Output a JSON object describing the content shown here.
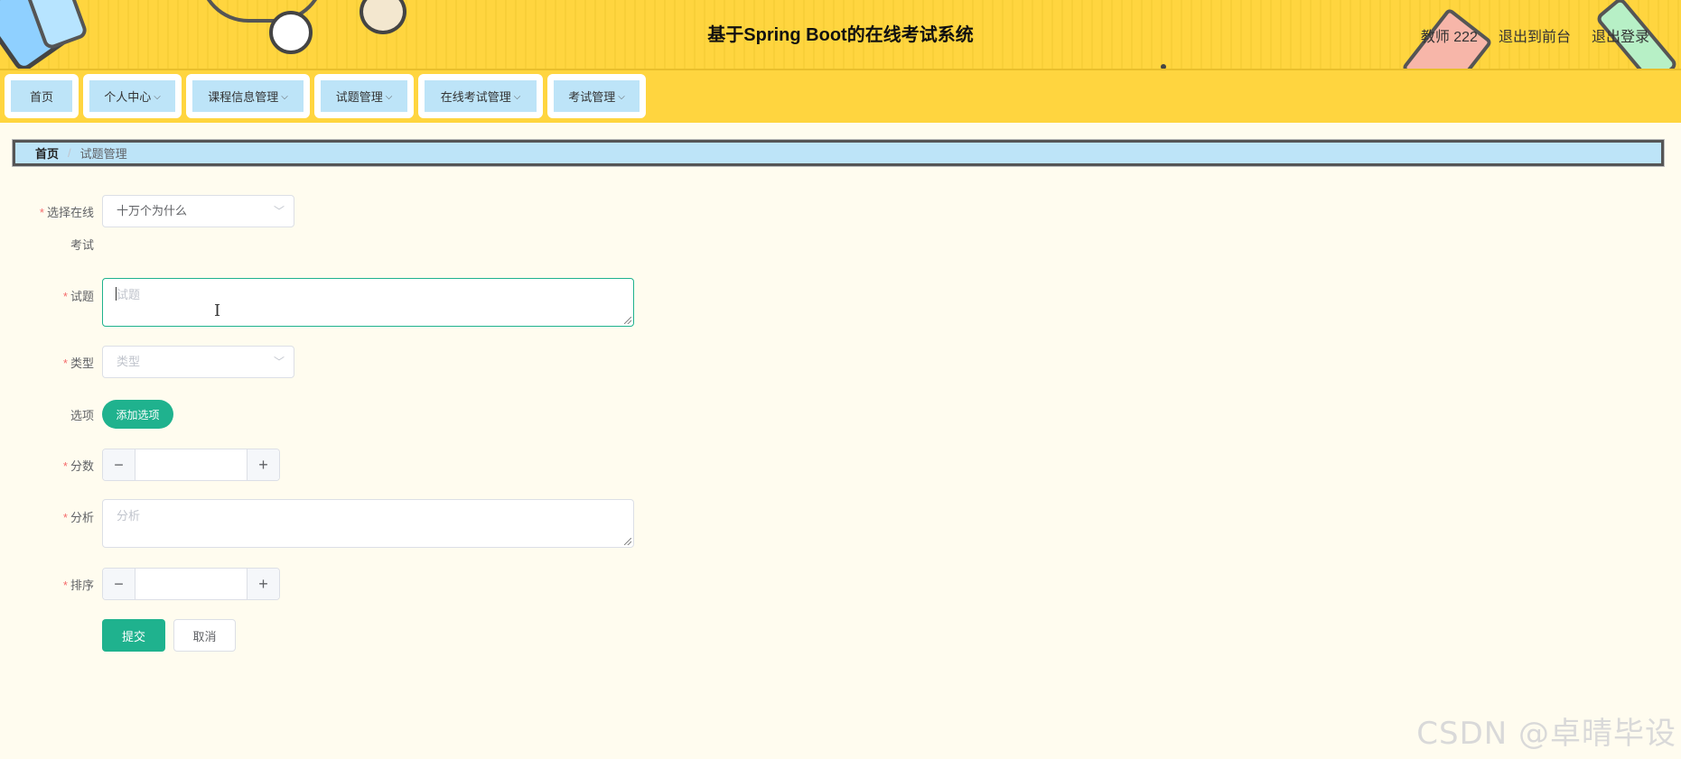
{
  "header": {
    "title": "基于Spring Boot的在线考试系统",
    "user_label": "教师 222",
    "back_to_front_label": "退出到前台",
    "logout_label": "退出登录"
  },
  "nav": {
    "items": [
      {
        "label": "首页",
        "has_dropdown": false
      },
      {
        "label": "个人中心",
        "has_dropdown": true
      },
      {
        "label": "课程信息管理",
        "has_dropdown": true
      },
      {
        "label": "试题管理",
        "has_dropdown": true
      },
      {
        "label": "在线考试管理",
        "has_dropdown": true
      },
      {
        "label": "考试管理",
        "has_dropdown": true
      }
    ],
    "chevron": "⌵"
  },
  "breadcrumb": {
    "home": "首页",
    "separator": "/",
    "current": "试题管理"
  },
  "form": {
    "required_mark": "*",
    "exam": {
      "label_line1": "选择在线",
      "label_line2": "考试",
      "value": "十万个为什么"
    },
    "question": {
      "label": "试题",
      "placeholder": "试题"
    },
    "type": {
      "label": "类型",
      "placeholder": "类型"
    },
    "options": {
      "label": "选项",
      "add_button": "添加选项"
    },
    "score": {
      "label": "分数",
      "value": "",
      "minus": "−",
      "plus": "+"
    },
    "analysis": {
      "label": "分析",
      "placeholder": "分析"
    },
    "order": {
      "label": "排序",
      "value": "",
      "minus": "−",
      "plus": "+"
    },
    "submit_label": "提交",
    "cancel_label": "取消"
  },
  "watermark": "CSDN @卓晴毕设",
  "colors": {
    "header_bg": "#ffd53f",
    "nav_item_bg": "#bde4f8",
    "primary": "#1fb28e",
    "page_bg": "#fffcef",
    "required": "#f56c6c"
  }
}
